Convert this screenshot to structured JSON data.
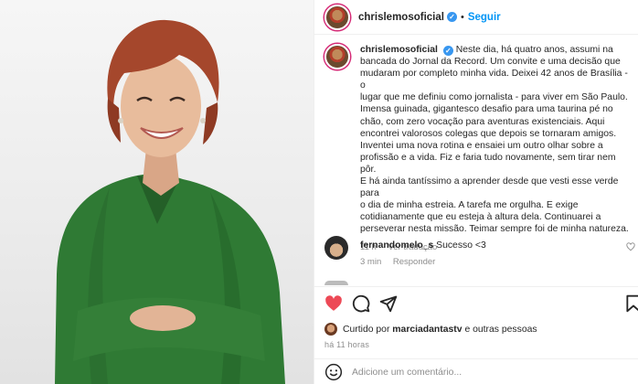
{
  "post": {
    "username": "chrislemosoficial",
    "verified_glyph": "✓",
    "dot": "•",
    "follow_label": "Seguir",
    "caption_lines": [
      "Neste dia, há quatro anos, assumi na",
      "bancada do Jornal da Record. Um convite e uma decisão que",
      "mudaram por completo minha vida. Deixei 42 anos de Brasília - o",
      "lugar que me definiu como jornalista - para viver em São Paulo.",
      "Imensa guinada, gigantesco desafio para uma taurina pé no",
      "chão, com zero vocação para aventuras existenciais. Aqui",
      "encontrei valorosos colegas que depois se tornaram amigos.",
      "Inventei uma nova rotina e ensaiei um outro olhar sobre a",
      "profissão e a vida. Fiz e faria tudo novamente, sem tirar nem pôr.",
      "E há ainda tantíssimo a aprender desde que vesti esse verde para",
      "o dia de minha estreia. A tarefa me orgulha. E exige",
      "cotidianamente que eu esteja à altura dela. Continuarei a",
      "perseverar nesta missão. Teimar sempre foi de minha natureza."
    ],
    "caption_time": "11 h",
    "see_translation": "Ver tradução"
  },
  "comment": {
    "username": "fernandomelo_s",
    "text": "Sucesso <3",
    "time": "3 min",
    "reply": "Responder"
  },
  "likes": {
    "prefix": "Curtido por",
    "user": "marciadantastv",
    "suffix": "e outras pessoas"
  },
  "time_ago": "há 11 horas",
  "add_comment": {
    "placeholder": "Adicione um comentário..."
  },
  "colors": {
    "accent": "#0095f6",
    "like": "#ed4956",
    "blouse": "#2f7a34",
    "hair": "#a5472c"
  }
}
